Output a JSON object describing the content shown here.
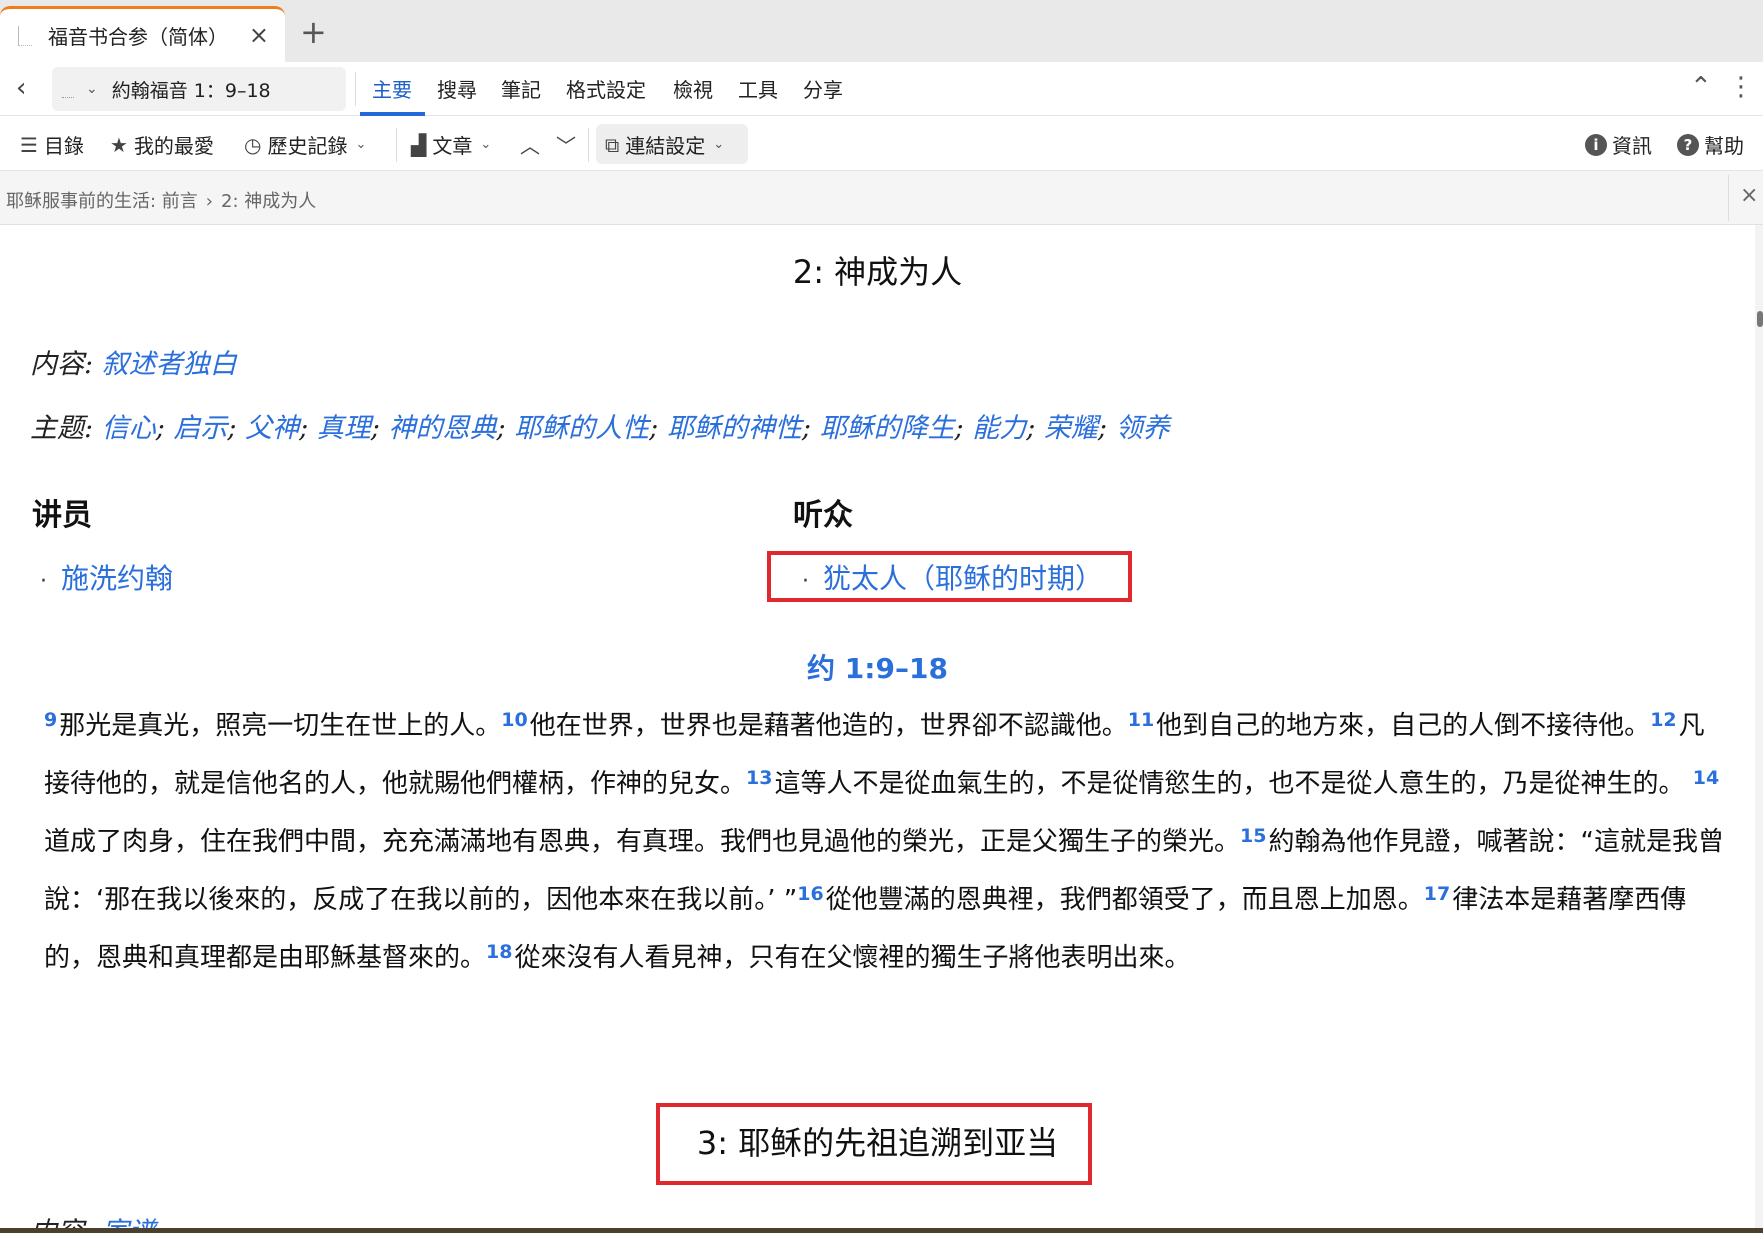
{
  "tab": {
    "title": "福音书合参（简体）",
    "close": "×",
    "new_tab": "+"
  },
  "menubar": {
    "back": "‹",
    "address_chevron": "⌄",
    "address_text": "約翰福音 1：9–18",
    "items": [
      "主要",
      "搜尋",
      "筆記",
      "格式設定",
      "檢視",
      "工具",
      "分享"
    ],
    "active_index": 0
  },
  "toolbar": {
    "toc": "目錄",
    "favorites": "我的最愛",
    "history": "歷史記錄",
    "article": "文章",
    "link_settings": "連結設定",
    "info": "資訊",
    "help": "幫助"
  },
  "breadcrumb": {
    "parts": [
      "耶稣服事前的生活: 前言",
      "2: 神成为人"
    ],
    "separator": "›",
    "close": "×"
  },
  "section1": {
    "title": "2: 神成为人",
    "content_label": "内容:",
    "content_value": "叙述者独白",
    "themes_label": "主题:",
    "themes": [
      "信心",
      "启示",
      "父神",
      "真理",
      "神的恩典",
      "耶稣的人性",
      "耶稣的神性",
      "耶稣的降生",
      "能力",
      "荣耀",
      "领养"
    ],
    "speakers_heading": "讲员",
    "audience_heading": "听众",
    "speaker": "施洗约翰",
    "audience": "犹太人（耶稣的时期）",
    "bullet": "·",
    "reference": "约 1:9–18",
    "verses": [
      {
        "n": "9",
        "t": "那光是真光，照亮一切生在世上的人。"
      },
      {
        "n": "10",
        "t": "他在世界，世界也是藉著他造的，世界卻不認識他。"
      },
      {
        "n": "11",
        "t": "他到自己的地方來，自己的人倒不接待他。"
      },
      {
        "n": "12",
        "t": "凡接待他的，就是信他名的人，他就賜他們權柄，作神的兒女。"
      },
      {
        "n": "13",
        "t": "這等人不是從血氣生的，不是從情慾生的，也不是從人意生的，乃是從神生的。 "
      },
      {
        "n": "14",
        "t": "道成了肉身，住在我們中間，充充滿滿地有恩典，有真理。我們也見過他的榮光，正是父獨生子的榮光。"
      },
      {
        "n": "15",
        "t": "約翰為他作見證，喊著說：“這就是我曾說：‘那在我以後來的，反成了在我以前的，因他本來在我以前。’ ”"
      },
      {
        "n": "16",
        "t": "從他豐滿的恩典裡，我們都領受了，而且恩上加恩。"
      },
      {
        "n": "17",
        "t": "律法本是藉著摩西傳的，恩典和真理都是由耶穌基督來的。"
      },
      {
        "n": "18",
        "t": "從來沒有人看見神，只有在父懷裡的獨生子將他表明出來。"
      }
    ]
  },
  "section2": {
    "title": "3: 耶稣的先祖追溯到亚当",
    "content_label": "内容:",
    "content_value": "家谱"
  },
  "colors": {
    "link": "#2a6fdb",
    "highlight": "#e0282f",
    "tab_accent": "#f07c1d"
  }
}
